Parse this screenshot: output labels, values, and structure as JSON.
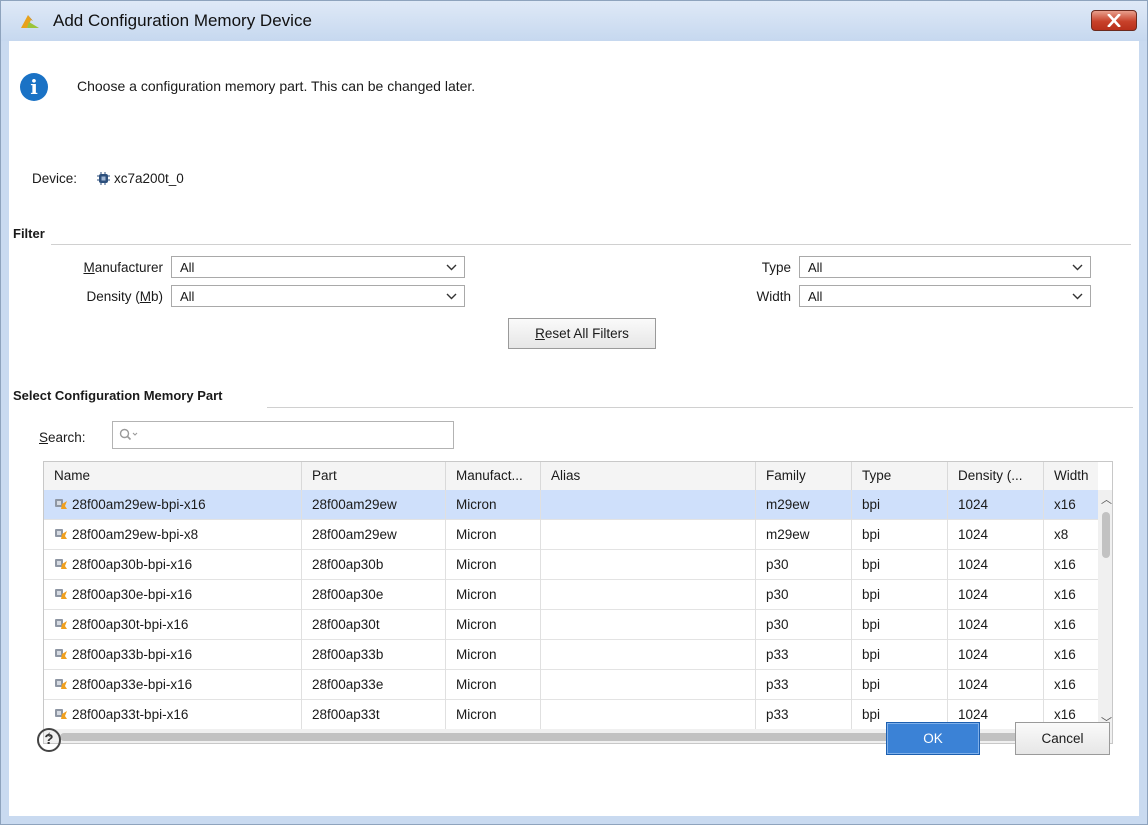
{
  "window": {
    "title": "Add Configuration Memory Device"
  },
  "info": {
    "message": "Choose a configuration memory part. This can be changed later."
  },
  "device": {
    "label": "Device:",
    "name": "xc7a200t_0"
  },
  "filter": {
    "heading": "Filter",
    "manufacturer": {
      "label_pre": "",
      "label_u": "M",
      "label_post": "anufacturer",
      "value": "All"
    },
    "density": {
      "label_pre": "Density (",
      "label_u": "M",
      "label_post": "b)",
      "value": "All"
    },
    "type": {
      "label": "Type",
      "value": "All"
    },
    "width": {
      "label": "Width",
      "value": "All"
    },
    "reset_u": "R",
    "reset_rest": "eset All Filters"
  },
  "select": {
    "heading": "Select Configuration Memory Part",
    "search_u": "S",
    "search_rest": "earch:"
  },
  "table": {
    "columns": [
      "Name",
      "Part",
      "Manufact...",
      "Alias",
      "Family",
      "Type",
      "Density (...",
      "Width"
    ],
    "rows": [
      {
        "name": "28f00am29ew-bpi-x16",
        "part": "28f00am29ew",
        "manufacturer": "Micron",
        "alias": "",
        "family": "m29ew",
        "type": "bpi",
        "density": "1024",
        "width": "x16"
      },
      {
        "name": "28f00am29ew-bpi-x8",
        "part": "28f00am29ew",
        "manufacturer": "Micron",
        "alias": "",
        "family": "m29ew",
        "type": "bpi",
        "density": "1024",
        "width": "x8"
      },
      {
        "name": "28f00ap30b-bpi-x16",
        "part": "28f00ap30b",
        "manufacturer": "Micron",
        "alias": "",
        "family": "p30",
        "type": "bpi",
        "density": "1024",
        "width": "x16"
      },
      {
        "name": "28f00ap30e-bpi-x16",
        "part": "28f00ap30e",
        "manufacturer": "Micron",
        "alias": "",
        "family": "p30",
        "type": "bpi",
        "density": "1024",
        "width": "x16"
      },
      {
        "name": "28f00ap30t-bpi-x16",
        "part": "28f00ap30t",
        "manufacturer": "Micron",
        "alias": "",
        "family": "p30",
        "type": "bpi",
        "density": "1024",
        "width": "x16"
      },
      {
        "name": "28f00ap33b-bpi-x16",
        "part": "28f00ap33b",
        "manufacturer": "Micron",
        "alias": "",
        "family": "p33",
        "type": "bpi",
        "density": "1024",
        "width": "x16"
      },
      {
        "name": "28f00ap33e-bpi-x16",
        "part": "28f00ap33e",
        "manufacturer": "Micron",
        "alias": "",
        "family": "p33",
        "type": "bpi",
        "density": "1024",
        "width": "x16"
      },
      {
        "name": "28f00ap33t-bpi-x16",
        "part": "28f00ap33t",
        "manufacturer": "Micron",
        "alias": "",
        "family": "p33",
        "type": "bpi",
        "density": "1024",
        "width": "x16"
      }
    ]
  },
  "footer": {
    "help": "?",
    "ok": "OK",
    "cancel": "Cancel"
  },
  "colors": {
    "accent": "#3b82d6",
    "selected_row": "#cfe0fb",
    "close_red": "#c8412a"
  }
}
